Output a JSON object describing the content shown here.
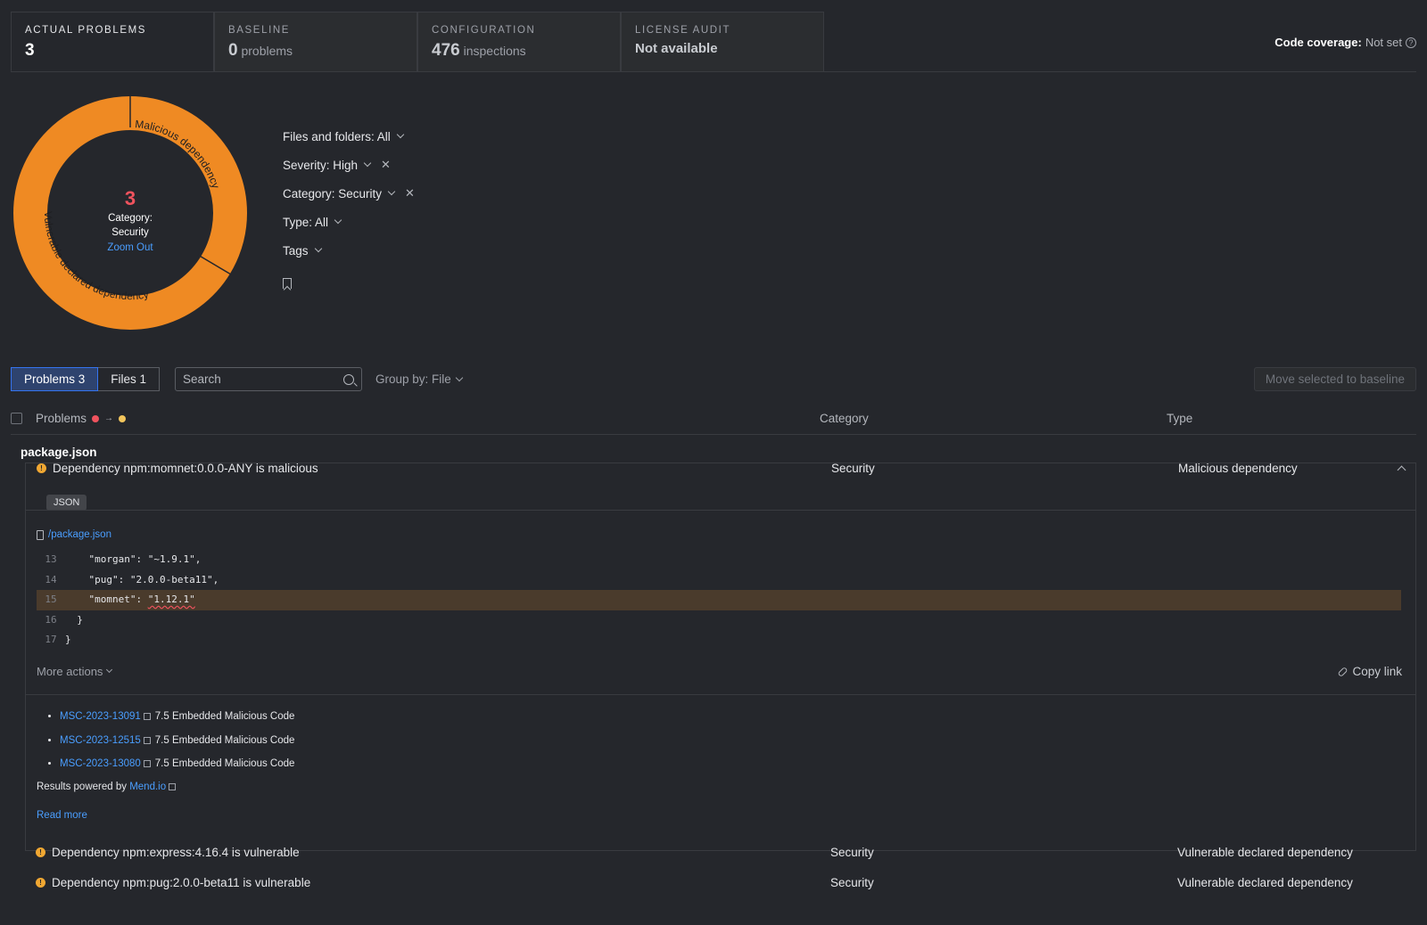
{
  "tabs": [
    {
      "label": "ACTUAL PROBLEMS",
      "value": "3",
      "suffix": ""
    },
    {
      "label": "BASELINE",
      "value": "0",
      "suffix": "problems"
    },
    {
      "label": "CONFIGURATION",
      "value": "476",
      "suffix": "inspections"
    },
    {
      "label": "LICENSE AUDIT",
      "value": "Not available",
      "suffix": ""
    }
  ],
  "coverage": {
    "label": "Code coverage:",
    "value": "Not set"
  },
  "donut": {
    "count": "3",
    "category_line1": "Category:",
    "category_line2": "Security",
    "zoom_out": "Zoom Out",
    "segments": [
      {
        "label": "Malicious dependency",
        "count": 1
      },
      {
        "label": "Vulnerable declared dependency",
        "count": 2
      }
    ],
    "color": "#ef8a23"
  },
  "filters": {
    "files": "Files and folders: All",
    "severity": "Severity: High",
    "category": "Category: Security",
    "type": "Type: All",
    "tags": "Tags"
  },
  "toolbar": {
    "problems_tab": "Problems 3",
    "files_tab": "Files 1",
    "search_placeholder": "Search",
    "group_by": "Group by: File",
    "move_button": "Move selected to baseline"
  },
  "table": {
    "col_problems": "Problems",
    "col_category": "Category",
    "col_type": "Type"
  },
  "file": "package.json",
  "expanded": {
    "title": "Dependency npm:momnet:0.0.0-ANY is malicious",
    "category": "Security",
    "type": "Malicious dependency",
    "tag": "JSON",
    "file_link": "/package.json",
    "code": [
      {
        "n": "13",
        "pre": "    \"morgan\": \"~1.9.1\",",
        "mark": "",
        "post": ""
      },
      {
        "n": "14",
        "pre": "    \"pug\": \"2.0.0-beta11\",",
        "mark": "",
        "post": ""
      },
      {
        "n": "15",
        "pre": "    \"momnet\": ",
        "mark": "\"1.12.1\"",
        "post": ""
      },
      {
        "n": "16",
        "pre": "  }",
        "mark": "",
        "post": ""
      },
      {
        "n": "17",
        "pre": "}",
        "mark": "",
        "post": ""
      }
    ],
    "more_actions": "More actions",
    "copy_link": "Copy link",
    "vulns": [
      {
        "id": "MSC-2023-13091",
        "desc": "7.5 Embedded Malicious Code"
      },
      {
        "id": "MSC-2023-12515",
        "desc": "7.5 Embedded Malicious Code"
      },
      {
        "id": "MSC-2023-13080",
        "desc": "7.5 Embedded Malicious Code"
      }
    ],
    "powered_prefix": "Results powered by",
    "powered_link": "Mend.io",
    "read_more": "Read more"
  },
  "rows": [
    {
      "title": "Dependency npm:express:4.16.4 is vulnerable",
      "category": "Security",
      "type": "Vulnerable declared dependency"
    },
    {
      "title": "Dependency npm:pug:2.0.0-beta11 is vulnerable",
      "category": "Security",
      "type": "Vulnerable declared dependency"
    }
  ]
}
